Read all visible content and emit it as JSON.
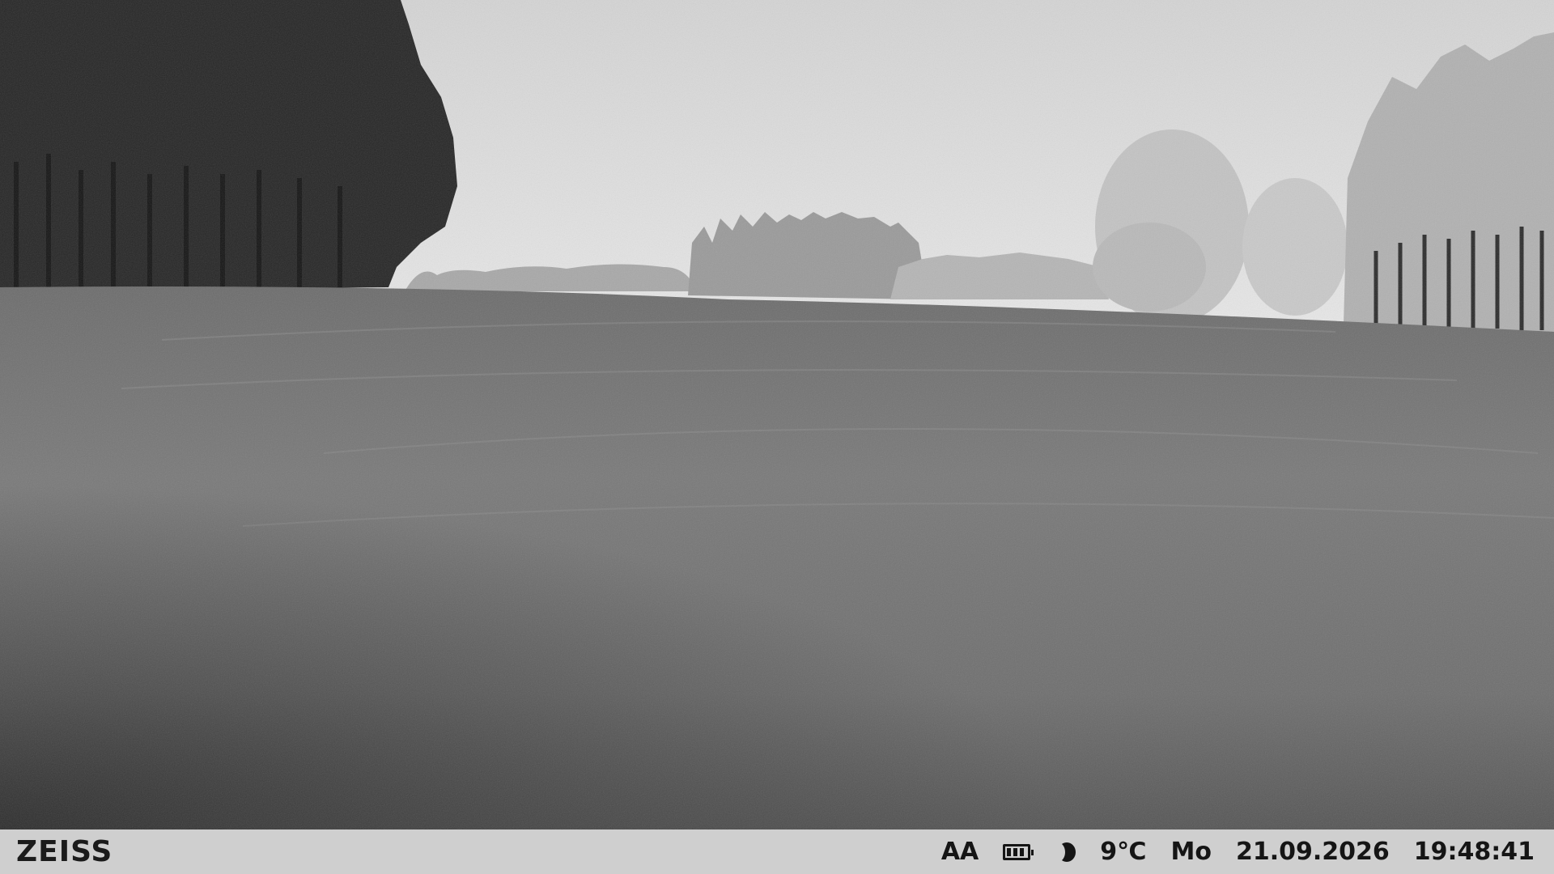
{
  "status_bar": {
    "brand": "ZEISS",
    "mode": "AA",
    "battery_icon": "battery-icon",
    "battery_level": 1.0,
    "moon_icon": "moon-phase-icon",
    "temperature": "9℃",
    "weekday": "Mo",
    "date": "21.09.2026",
    "time": "19:48:41"
  },
  "colors": {
    "status_bar_bg": "#cfcfcf",
    "status_bar_text": "#151515"
  }
}
